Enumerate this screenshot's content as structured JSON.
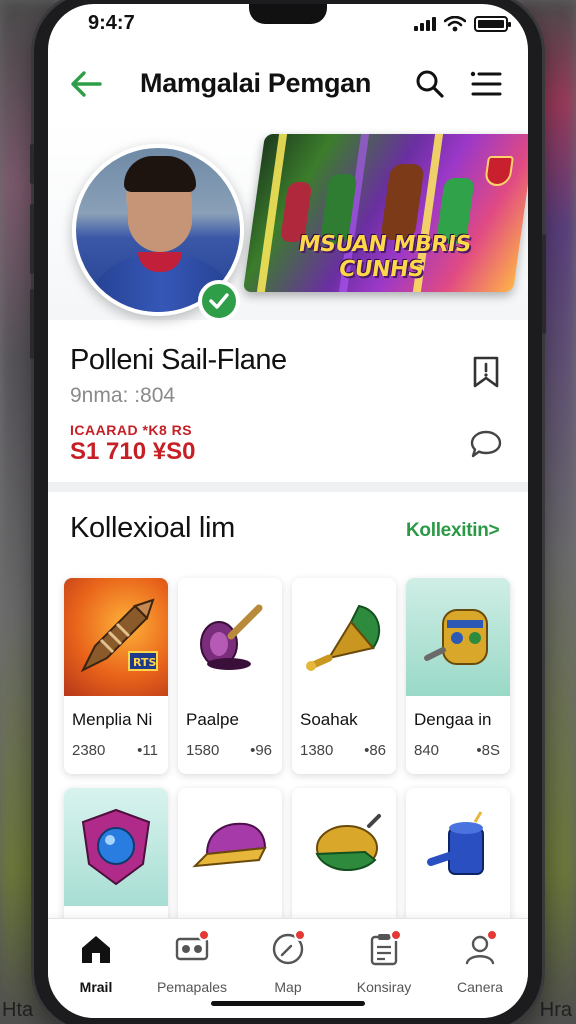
{
  "background": {
    "caption_left": "Hta",
    "caption_right": "Hra"
  },
  "status_bar": {
    "time": "9:4:7",
    "icons": [
      "signal-icon",
      "wifi-icon",
      "battery-icon"
    ]
  },
  "header": {
    "title": "Mamgalai Pemgan",
    "back_icon": "arrow-left-icon",
    "search_icon": "search-icon",
    "menu_icon": "menu-list-icon",
    "accent_color": "#2e9e48"
  },
  "profile": {
    "banner_text": "MSUAN MBRIS CUNHS",
    "verified_icon": "check-icon",
    "name": "Polleni Sail-Flane",
    "meta": "9nma: :804",
    "stats_label": "ICAARAD *K8 RS",
    "stats_value": "S1 710 ¥S0",
    "stats_color": "#c62026",
    "bookmark_icon": "bookmark-alert-icon",
    "chat_icon": "chat-bubble-icon"
  },
  "collection": {
    "title": "Kollexioal lim",
    "link": "Kollexitin>",
    "link_color": "#2b9a45",
    "items": [
      {
        "name": "Menplia Ni",
        "price": "2380",
        "qty": "•11",
        "icon": "dart-missile-icon"
      },
      {
        "name": "Paalpe",
        "price": "1580",
        "qty": "•96",
        "icon": "trumpet-icon"
      },
      {
        "name": "Soahak",
        "price": "1380",
        "qty": "•86",
        "icon": "horn-icon"
      },
      {
        "name": "Dengaa in",
        "price": "840",
        "qty": "•8S",
        "icon": "golden-cannon-icon"
      },
      {
        "name": "",
        "price": "",
        "qty": "",
        "icon": "shield-orb-icon"
      },
      {
        "name": "",
        "price": "",
        "qty": "",
        "icon": "cap-icon"
      },
      {
        "name": "",
        "price": "",
        "qty": "",
        "icon": "gold-horn-icon"
      },
      {
        "name": "",
        "price": "",
        "qty": "",
        "icon": "blue-drum-icon"
      }
    ]
  },
  "bottom_nav": {
    "items": [
      {
        "label": "Mrail",
        "icon": "home-icon",
        "active": true,
        "badge": false
      },
      {
        "label": "Pemapales",
        "icon": "ticket-icon",
        "active": false,
        "badge": true
      },
      {
        "label": "Map",
        "icon": "compass-icon",
        "active": false,
        "badge": true
      },
      {
        "label": "Konsiray",
        "icon": "clipboard-icon",
        "active": false,
        "badge": true
      },
      {
        "label": "Canera",
        "icon": "profile-icon",
        "active": false,
        "badge": true
      }
    ]
  }
}
